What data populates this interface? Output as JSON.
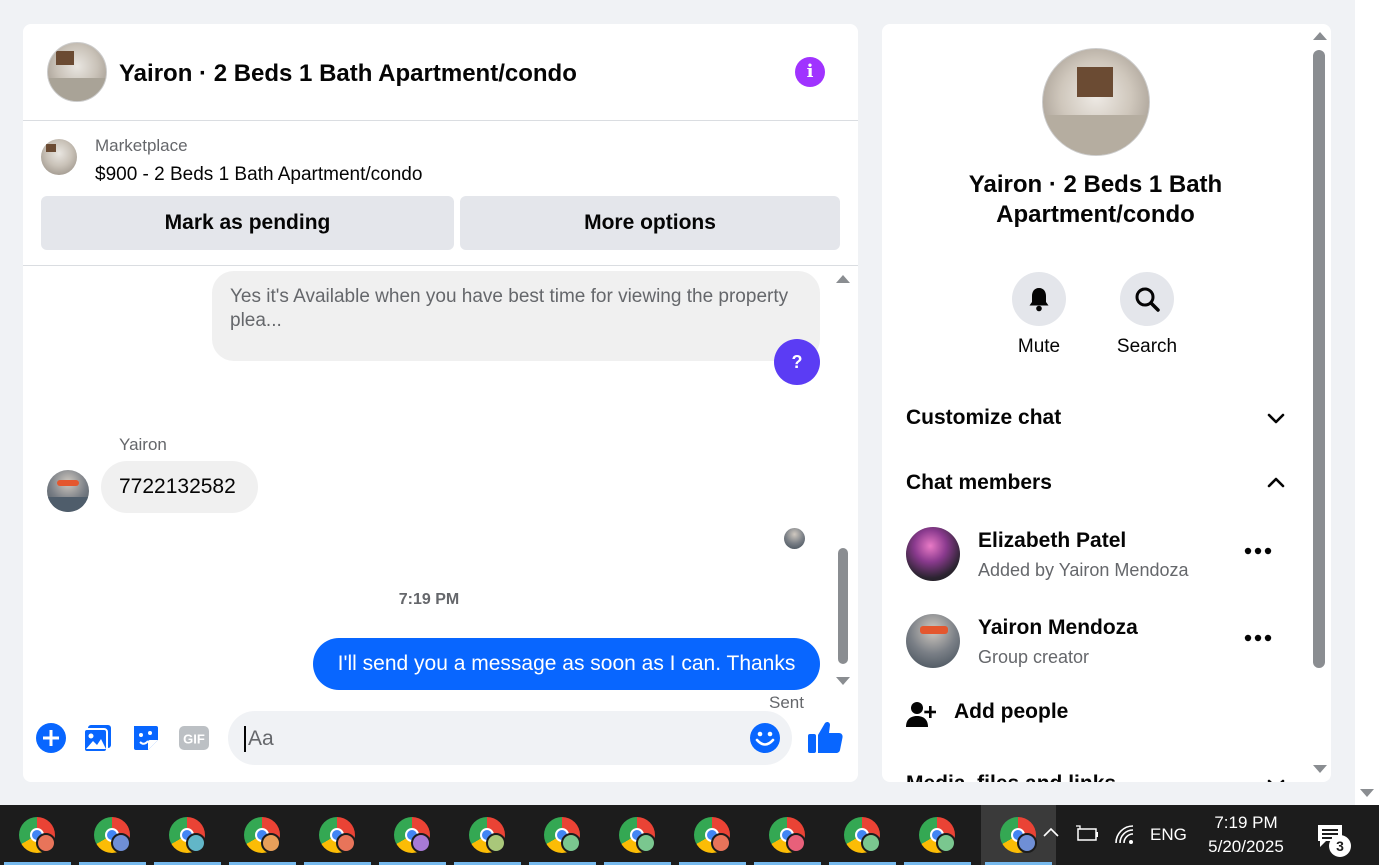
{
  "header": {
    "title": "Yairon · 2 Beds 1 Bath Apartment/condo",
    "info_icon": "i"
  },
  "marketplace": {
    "label": "Marketplace",
    "item": "$900 - 2 Beds 1 Bath Apartment/condo",
    "pending_button": "Mark as pending",
    "more_button": "More options"
  },
  "messages": {
    "reply_preview": "Yes it's Available when you have best time for viewing the property plea...",
    "question_badge": "?",
    "sender_name": "Yairon",
    "phone_message": "7722132582",
    "time_separator": "7:19 PM",
    "sent_message": "I'll send you a message as soon as I can. Thanks",
    "sent_status": "Sent"
  },
  "composer": {
    "placeholder": "Aa",
    "icons": [
      "plus-icon",
      "photo-icon",
      "sticker-icon",
      "gif-icon",
      "emoji-icon",
      "like-icon"
    ],
    "accent": "#0866ff"
  },
  "panel": {
    "title": "Yairon · 2 Beds 1 Bath Apartment/condo",
    "mute_label": "Mute",
    "search_label": "Search",
    "customize_label": "Customize chat",
    "members_label": "Chat members",
    "members": [
      {
        "name": "Elizabeth Patel",
        "sub": "Added by Yairon Mendoza"
      },
      {
        "name": "Yairon Mendoza",
        "sub": "Group creator"
      }
    ],
    "add_people": "Add people",
    "media_label": "Media, files and links"
  },
  "taskbar": {
    "language": "ENG",
    "time": "7:19 PM",
    "date": "5/20/2025",
    "notifications": "3",
    "apps": [
      {
        "profile_color": "#e8745a"
      },
      {
        "profile_color": "#6f8fd6"
      },
      {
        "profile_color": "#62b6c8"
      },
      {
        "profile_color": "#e8a05a"
      },
      {
        "profile_color": "#e8745a"
      },
      {
        "profile_color": "#a77ad6"
      },
      {
        "profile_color": "#a9c77a"
      },
      {
        "profile_color": "#7ac78f"
      },
      {
        "profile_color": "#7ac78f"
      },
      {
        "profile_color": "#e8745a"
      },
      {
        "profile_color": "#e8607a"
      },
      {
        "profile_color": "#7ac78f"
      },
      {
        "profile_color": "#7ac78f"
      },
      {
        "profile_color": "#6f8fd6"
      }
    ]
  },
  "colors": {
    "accent_blue": "#0866ff",
    "purple_info": "#a033ff",
    "badge_purple": "#5b3cf4"
  }
}
